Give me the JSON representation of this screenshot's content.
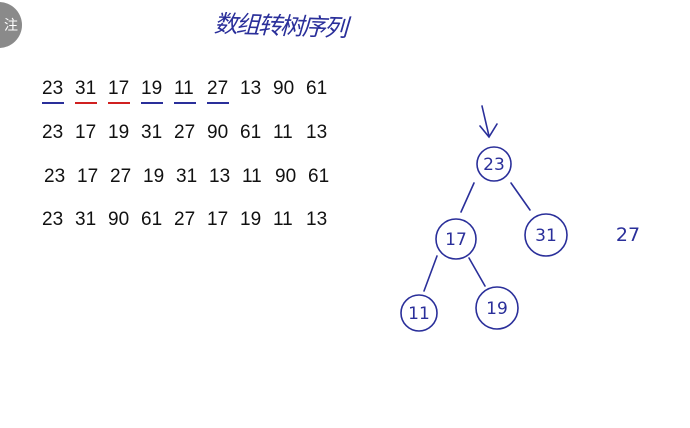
{
  "avatar": {
    "label": "注"
  },
  "title": {
    "text": "数组转树序列"
  },
  "sequences": [
    {
      "numbers": [
        "23",
        "31",
        "17",
        "19",
        "11",
        "27",
        "13",
        "90",
        "61"
      ],
      "underlines": [
        "blue",
        "red",
        "red",
        "blue",
        "blue",
        "blue",
        "",
        "",
        ""
      ]
    },
    {
      "numbers": [
        "23",
        "17",
        "19",
        "31",
        "27",
        "90",
        "61",
        "11",
        "13"
      ]
    },
    {
      "numbers": [
        "23",
        "17",
        "27",
        "19",
        "31",
        "13",
        "11",
        "90",
        "61"
      ]
    },
    {
      "numbers": [
        "23",
        "31",
        "90",
        "61",
        "27",
        "17",
        "19",
        "11",
        "13"
      ]
    }
  ],
  "tree": {
    "nodes": [
      {
        "label": "23"
      },
      {
        "label": "17"
      },
      {
        "label": "31"
      },
      {
        "label": "11"
      },
      {
        "label": "19"
      }
    ],
    "pending_label": "27",
    "arrow_icon": "down-arrow-icon"
  },
  "colors": {
    "ink": "#2a2f9a",
    "underline_blue": "#2a2f9a",
    "underline_red": "#d02020"
  }
}
